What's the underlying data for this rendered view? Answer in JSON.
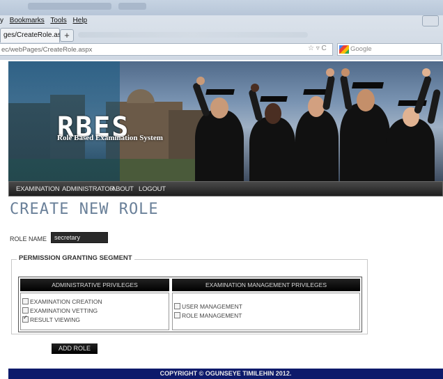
{
  "browser": {
    "menu": [
      "Bookmarks",
      "Tools",
      "Help"
    ],
    "menu_prefix": "y",
    "tab_label": "ges/CreateRole.aspx",
    "new_tab": "+",
    "url": "ec/webPages/CreateRole.aspx",
    "nav_glyphs": "☆ ▿ C",
    "search_placeholder": "Google"
  },
  "banner": {
    "logo": "RBES",
    "tagline": "Role Based Examination System"
  },
  "nav": [
    "EXAMINATION",
    "ADMINISTRATOR",
    "ABOUT",
    "LOGOUT"
  ],
  "page": {
    "heading": "CREATE NEW ROLE",
    "role_label": "ROLE NAME",
    "role_value": "secretary"
  },
  "permissions": {
    "legend": "PERMISSION GRANTING SEGMENT",
    "col1_header": "ADMINISTRATIVE PRIVILEGES",
    "col2_header": "EXAMINATION MANAGEMENT PRIVILEGES",
    "admin": [
      {
        "label": "EXAMINATION CREATION",
        "checked": false
      },
      {
        "label": "EXAMINATION VETTING",
        "checked": false
      },
      {
        "label": "RESULT VIEWING",
        "checked": true
      }
    ],
    "exam": [
      {
        "label": "USER MANAGEMENT",
        "checked": false
      },
      {
        "label": "ROLE MANAGEMENT",
        "checked": false
      }
    ]
  },
  "actions": {
    "add_role": "ADD ROLE"
  },
  "footer": "COPYRIGHT © OGUNSEYE TIMILEHIN 2012."
}
